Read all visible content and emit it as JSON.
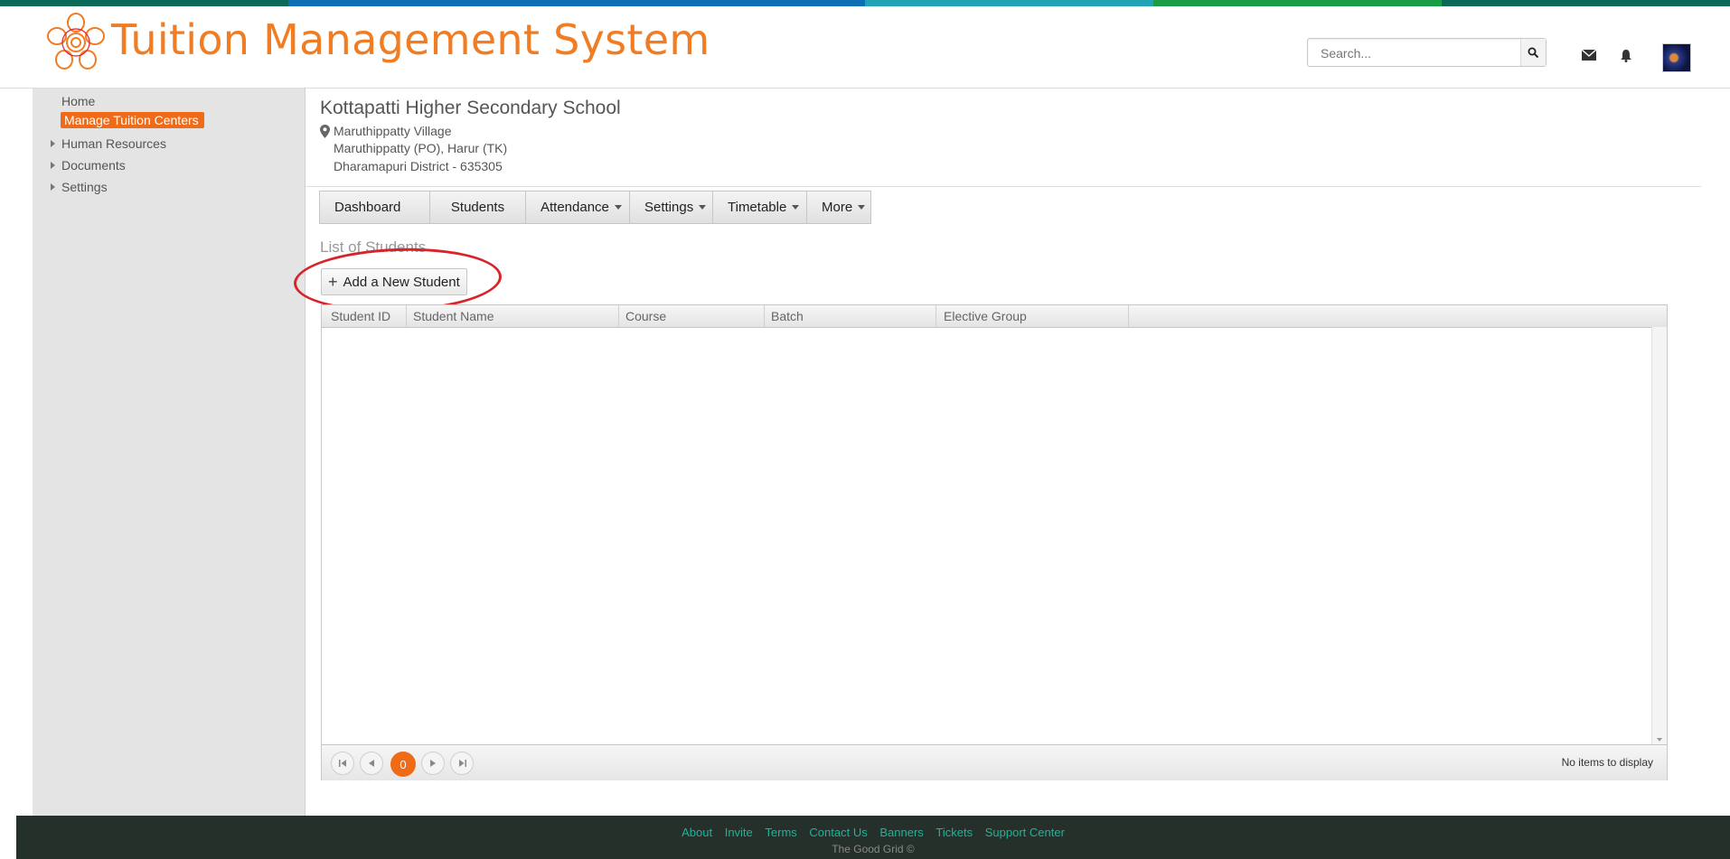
{
  "colors": {
    "accent": "#f07d24",
    "active": "#f06b17",
    "footer_bg": "#243029",
    "footer_link": "#1fb39b",
    "stripe": [
      "#0a6a57",
      "#0d6fb3",
      "#0d6fb3",
      "#1fa3b5",
      "#1a9b45",
      "#0a6a57"
    ]
  },
  "header": {
    "title": "Tuition Management System",
    "search_placeholder": "Search...",
    "icons": [
      "search-icon",
      "envelope-icon",
      "bell-icon"
    ]
  },
  "sidebar": {
    "items": [
      {
        "label": "Home"
      },
      {
        "label": "Manage Tuition  Centers"
      },
      {
        "label": "Human Resources"
      },
      {
        "label": "Documents"
      },
      {
        "label": "Settings"
      }
    ]
  },
  "school": {
    "name": "Kottapatti Higher Secondary School",
    "address": [
      "Maruthippatty Village",
      "Maruthippatty (PO), Harur (TK)",
      "Dharamapuri District - 635305"
    ]
  },
  "tabs": [
    {
      "label": "Dashboard"
    },
    {
      "label": "Students"
    },
    {
      "label": "Attendance"
    },
    {
      "label": "Settings"
    },
    {
      "label": "Timetable"
    },
    {
      "label": "More"
    }
  ],
  "students": {
    "list_title": "List of Students",
    "add_label": "Add a New Student",
    "columns": [
      "Student ID",
      "Student Name",
      "Course",
      "Batch",
      "Elective Group"
    ],
    "current_page": "0",
    "no_items": "No items to display"
  },
  "footer": {
    "links": [
      "About",
      "Invite",
      "Terms",
      "Contact Us",
      "Banners",
      "Tickets",
      "Support Center"
    ],
    "copyright": "The Good Grid ©"
  }
}
